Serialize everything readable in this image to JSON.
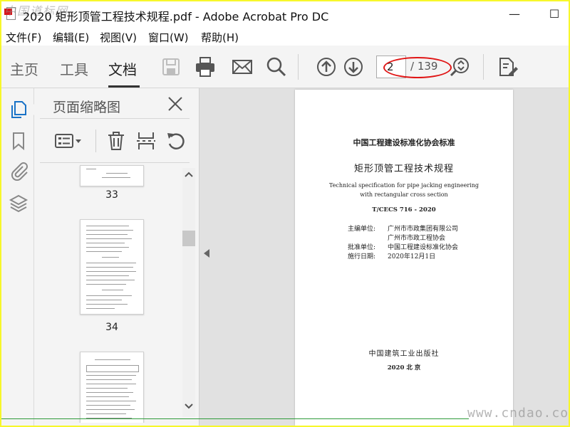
{
  "window": {
    "title": "2020 矩形顶管工程技术规程.pdf - Adobe Acrobat Pro DC",
    "watermark_top": "中国道标网",
    "watermark_bottom": "www.cndao.com",
    "minimize_glyph": "—",
    "maximize_glyph": "☐"
  },
  "menu": [
    "文件(F)",
    "编辑(E)",
    "视图(V)",
    "窗口(W)",
    "帮助(H)"
  ],
  "toolbar": {
    "tabs": [
      "主页",
      "工具",
      "文档"
    ],
    "active_tab": "文档",
    "page_current": "2",
    "page_total": "/ 139",
    "icons": [
      "save-icon",
      "print-icon",
      "email-icon",
      "search-icon",
      "page-up-icon",
      "page-down-icon",
      "zoom-icon",
      "fill-sign-icon"
    ]
  },
  "left_rail": {
    "icons": [
      "page-thumbnails-icon",
      "bookmark-icon",
      "attachment-icon",
      "layers-icon"
    ]
  },
  "thumbnail_panel": {
    "title": "页面缩略图",
    "tools": [
      "options-icon",
      "delete-icon",
      "extract-icon",
      "rotate-icon"
    ],
    "thumbnails": [
      {
        "page": "33"
      },
      {
        "page": "34"
      }
    ]
  },
  "document_page": {
    "organization": "中国工程建设标准化协会标准",
    "title_cn": "矩形顶管工程技术规程",
    "title_en_1": "Technical specification for pipe jacking engineering",
    "title_en_2": "with rectangular cross section",
    "code": "T/CECS 716 - 2020",
    "rows": [
      {
        "label": "主编单位:",
        "value": "广州市市政集团有限公司"
      },
      {
        "label": "",
        "value": "广州市市政工程协会"
      },
      {
        "label": "批准单位:",
        "value": "中国工程建设标准化协会"
      },
      {
        "label": "施行日期:",
        "value": "2020年12月1日"
      }
    ],
    "publisher": "中国建筑工业出版社",
    "city": "2020    北    京"
  },
  "colors": {
    "accent_red": "#e01515",
    "frame_yellow": "#f7f72a",
    "toolbar_bg": "#f4f4f4"
  }
}
